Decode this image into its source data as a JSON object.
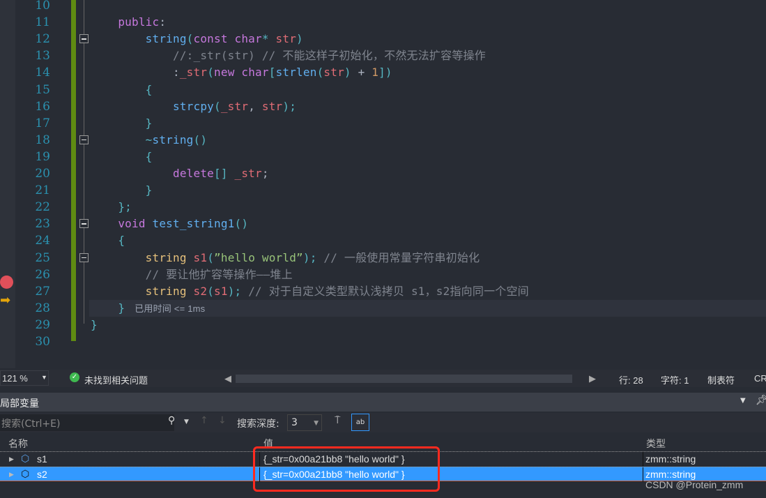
{
  "editor": {
    "lines": [
      {
        "n": "10",
        "t": []
      },
      {
        "n": "11",
        "t": [
          [
            "    ",
            "tx"
          ],
          [
            "public",
            "kw"
          ],
          [
            ":",
            "tx"
          ]
        ]
      },
      {
        "n": "12",
        "fold": true,
        "t": [
          [
            "        ",
            "tx"
          ],
          [
            "string",
            "fn"
          ],
          [
            "(",
            "pu"
          ],
          [
            "const ",
            "kw"
          ],
          [
            "char",
            "kw"
          ],
          [
            "* ",
            "pu"
          ],
          [
            "str",
            "pr"
          ],
          [
            ")",
            "pu"
          ]
        ]
      },
      {
        "n": "13",
        "t": [
          [
            "            ",
            "tx"
          ],
          [
            "//:_str(str) // 不能这样子初始化，不然无法扩容等操作",
            "cm"
          ]
        ]
      },
      {
        "n": "14",
        "t": [
          [
            "            ",
            "tx"
          ],
          [
            ":",
            "tx"
          ],
          [
            "_str",
            "pr"
          ],
          [
            "(",
            "pu"
          ],
          [
            "new ",
            "kw"
          ],
          [
            "char",
            "kw"
          ],
          [
            "[",
            "pu"
          ],
          [
            "strlen",
            "fn"
          ],
          [
            "(",
            "pu"
          ],
          [
            "str",
            "pr"
          ],
          [
            ")",
            "pu"
          ],
          [
            " + ",
            "tx"
          ],
          [
            "1",
            "nu"
          ],
          [
            "])",
            "pu"
          ]
        ]
      },
      {
        "n": "15",
        "t": [
          [
            "        ",
            "tx"
          ],
          [
            "{",
            "pu"
          ]
        ]
      },
      {
        "n": "16",
        "t": [
          [
            "            ",
            "tx"
          ],
          [
            "strcpy",
            "fn"
          ],
          [
            "(",
            "pu"
          ],
          [
            "_str",
            "pr"
          ],
          [
            ", ",
            "tx"
          ],
          [
            "str",
            "pr"
          ],
          [
            ");",
            "pu"
          ]
        ]
      },
      {
        "n": "17",
        "t": [
          [
            "        ",
            "tx"
          ],
          [
            "}",
            "pu"
          ]
        ]
      },
      {
        "n": "18",
        "fold": true,
        "t": [
          [
            "        ",
            "tx"
          ],
          [
            "~",
            "pu"
          ],
          [
            "string",
            "fn"
          ],
          [
            "()",
            "pu"
          ]
        ]
      },
      {
        "n": "19",
        "t": [
          [
            "        ",
            "tx"
          ],
          [
            "{",
            "pu"
          ]
        ]
      },
      {
        "n": "20",
        "t": [
          [
            "            ",
            "tx"
          ],
          [
            "delete",
            "kw"
          ],
          [
            "[] ",
            "pu"
          ],
          [
            "_str",
            "pr"
          ],
          [
            ";",
            "tx"
          ]
        ]
      },
      {
        "n": "21",
        "t": [
          [
            "        ",
            "tx"
          ],
          [
            "}",
            "pu"
          ]
        ]
      },
      {
        "n": "22",
        "t": [
          [
            "    ",
            "tx"
          ],
          [
            "};",
            "pu"
          ]
        ]
      },
      {
        "n": "23",
        "fold": true,
        "t": [
          [
            "    ",
            "tx"
          ],
          [
            "void ",
            "kw"
          ],
          [
            "test_string1",
            "fn"
          ],
          [
            "()",
            "pu"
          ]
        ]
      },
      {
        "n": "24",
        "t": [
          [
            "    ",
            "tx"
          ],
          [
            "{",
            "pu"
          ]
        ]
      },
      {
        "n": "25",
        "fold": true,
        "t": [
          [
            "        ",
            "tx"
          ],
          [
            "string ",
            "ty"
          ],
          [
            "s1",
            "pr"
          ],
          [
            "(",
            "pu"
          ],
          [
            "”hello world”",
            "st"
          ],
          [
            ");",
            "pu"
          ],
          [
            " // 一般使用常量字符串初始化",
            "cm"
          ]
        ]
      },
      {
        "n": "26",
        "t": [
          [
            "        ",
            "tx"
          ],
          [
            "// 要让他扩容等操作——堆上",
            "cm"
          ]
        ]
      },
      {
        "n": "27",
        "t": [
          [
            "        ",
            "tx"
          ],
          [
            "string ",
            "ty"
          ],
          [
            "s2",
            "pr"
          ],
          [
            "(",
            "pu"
          ],
          [
            "s1",
            "pr"
          ],
          [
            ");",
            "pu"
          ],
          [
            " // 对于自定义类型默认浅拷贝 s1，s2指向同一个空间",
            "cm"
          ]
        ]
      },
      {
        "n": "28",
        "current": true,
        "hint": "已用时间 <= 1ms",
        "t": [
          [
            "    ",
            "tx"
          ],
          [
            "}",
            "pu"
          ]
        ]
      },
      {
        "n": "29",
        "t": [
          [
            "}",
            "pu"
          ]
        ]
      },
      {
        "n": "30",
        "t": []
      }
    ]
  },
  "status": {
    "zoom": "121 %",
    "issues": "未找到相关问题",
    "line": "行: 28",
    "char": "字符: 1",
    "tabs": "制表符",
    "eol": "CR"
  },
  "panel": {
    "title": "局部变量",
    "search_placeholder": "搜索(Ctrl+E)",
    "depth_label": "搜索深度:",
    "depth": "3",
    "columns": {
      "name": "名称",
      "value": "值",
      "type": "类型"
    },
    "rows": [
      {
        "name": "s1",
        "value": "{_str=0x00a21bb8 \"hello world\" }",
        "type": "zmm::string"
      },
      {
        "name": "s2",
        "value": "{_str=0x00a21bb8 \"hello world\" }",
        "type": "zmm::string",
        "selected": true
      }
    ]
  },
  "watermark": "CSDN @Protein_zmm",
  "colors": {
    "accent": "#3399ff",
    "highlight": "#ff2a1f",
    "breakpoint": "#e0505a"
  }
}
